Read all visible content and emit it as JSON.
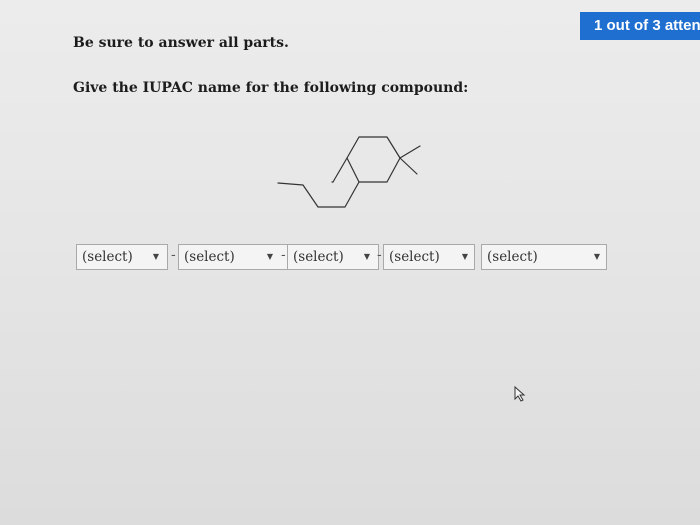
{
  "header": {
    "attempt_label": "1 out of 3 atten"
  },
  "instructions": {
    "note": "Be sure to answer all parts.",
    "question": "Give the IUPAC name for the following compound:"
  },
  "structure": {
    "icon": "chemical-structure-icon"
  },
  "answer": {
    "selects": [
      {
        "label": "(select)"
      },
      {
        "label": "(select)"
      },
      {
        "label": "(select)"
      },
      {
        "label": "(select)"
      },
      {
        "label": "(select)"
      }
    ],
    "separator": "-",
    "arrow_glyph": "▼"
  },
  "cursor": {
    "icon": "mouse-pointer-icon"
  },
  "colors": {
    "badge": "#1f6fd1",
    "background": "#e6e6e6"
  }
}
